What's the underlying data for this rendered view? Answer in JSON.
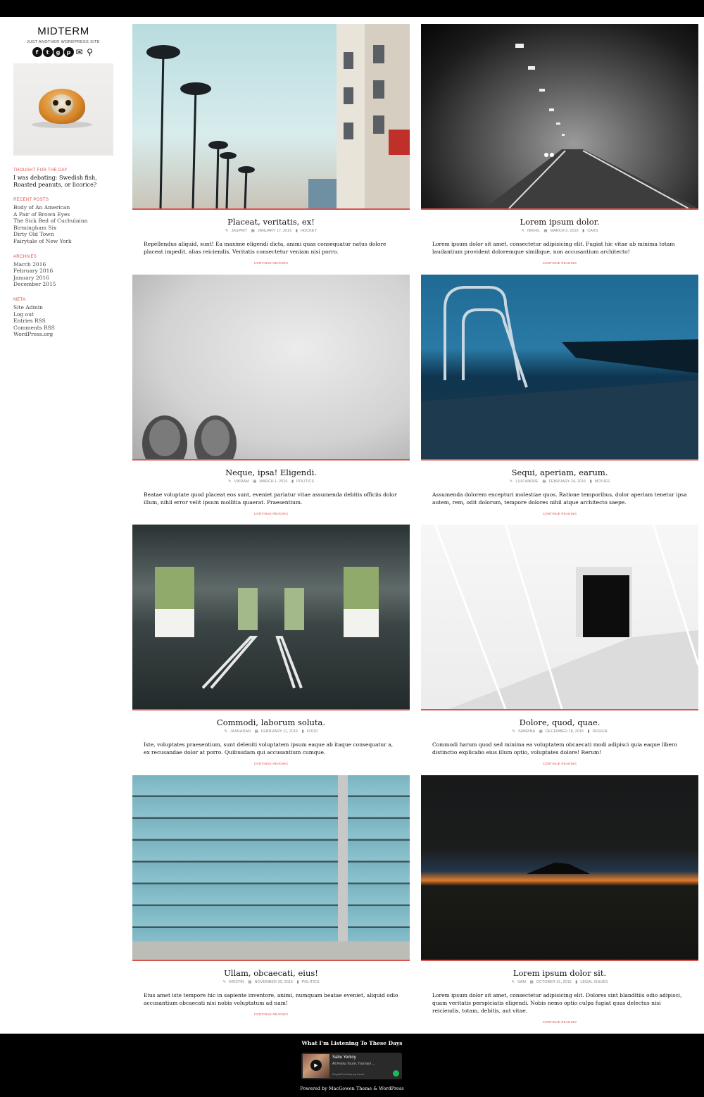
{
  "site": {
    "title": "MIDTERM",
    "description": "JUST ANOTHER WORDPRESS SITE"
  },
  "social_icons": [
    "facebook-icon",
    "twitter-icon",
    "google-plus-icon",
    "pinterest-icon",
    "email-icon",
    "search-icon"
  ],
  "sidebar": {
    "thought": {
      "title": "THOUGHT FOR THE DAY",
      "text": "I was debating: Swedish fish, Roasted peanuts, or licorice?"
    },
    "recent_posts": {
      "title": "RECENT POSTS",
      "items": [
        "Body of An American",
        "A Pair of Brown Eyes",
        "The Sick Bed of Cuchulainn",
        "Birmingham Six",
        "Dirty Old Town",
        "Fairytale of New York"
      ]
    },
    "archives": {
      "title": "ARCHIVES",
      "items": [
        "March 2016",
        "February 2016",
        "January 2016",
        "December 2015"
      ]
    },
    "meta": {
      "title": "META",
      "items": [
        "Site Admin",
        "Log out",
        "Entries RSS",
        "Comments RSS",
        "WordPress.org"
      ]
    }
  },
  "posts": [
    {
      "title": "Placeat, veritatis, ex!",
      "author": "JASPRIT",
      "date": "JANUARY 17, 2016",
      "category": "HOCKEY",
      "excerpt": "Repellendus aliquid, sunt! Ea maxime eligendi dicta, animi quas consequatur natus dolore placeat impedit, alias reiciendis. Veritatis consectetur veniam nisi porro.",
      "more": "CONTINUE READING"
    },
    {
      "title": "Lorem ipsum dolor.",
      "author": "NIKHIL",
      "date": "MARCH 2, 2016",
      "category": "CARS",
      "excerpt": "Lorem ipsum dolor sit amet, consectetur adipisicing elit. Fugiat hic vitae ab minima totam laudantium provident doloremque similique, non accusantium architecto!",
      "more": "CONTINUE READING"
    },
    {
      "title": "Neque, ipsa! Eligendi.",
      "author": "VIKRAM",
      "date": "MARCH 1, 2016",
      "category": "POLITICS",
      "excerpt": "Beatae voluptate quod placeat eos sunt, eveniet pariatur vitae assumenda debitis officiis dolor illum, nihil error velit ipsum mollitia quaerat. Praesentium.",
      "more": "CONTINUE READING"
    },
    {
      "title": "Sequi, aperiam, earum.",
      "author": "LUIZ ANDRE",
      "date": "FEBRUARY 24, 2016",
      "category": "MOVIES",
      "excerpt": "Assumenda dolorem excepturi molestiae quos. Ratione temporibus, dolor aperiam tenetur ipsa autem, rem, odit dolorum, tempore dolores nihil atque architecto saepe.",
      "more": "CONTINUE READING"
    },
    {
      "title": "Commodi, laborum soluta.",
      "author": "JASKARAN",
      "date": "FEBRUARY 11, 2016",
      "category": "FOOD",
      "excerpt": "Iste, voluptates praesentium, sunt deleniti voluptatem ipsum eaque ab itaque consequatur a, ex recusandae dolor at porro. Quibusdam qui accusantium cumque.",
      "more": "CONTINUE READING"
    },
    {
      "title": "Dolore, quod, quae.",
      "author": "SABRINA",
      "date": "DECEMBER 18, 2015",
      "category": "DESIGN",
      "excerpt": "Commodi harum quod sed minima ea voluptatem obcaecati modi adipisci quia eaque libero distinctio explicabo eius illum optio, voluptates dolore! Rerum!",
      "more": "CONTINUE READING"
    },
    {
      "title": "Ullam, obcaecati, eius!",
      "author": "KIRSTIN",
      "date": "NOVEMBER 30, 2015",
      "category": "POLITICS",
      "excerpt": "Eius amet iste tempore hic in sapiente inventore, animi, numquam beatae eveniet, aliquid odio accusantium obcaecati nisi nobis voluptatum ad nam!",
      "more": "CONTINUE READING"
    },
    {
      "title": "Lorem ipsum dolor sit.",
      "author": "SAM",
      "date": "OCTOBER 31, 2015",
      "category": "LEGAL ISSUES",
      "excerpt": "Lorem ipsum dolor sit amet, consectetur adipisicing elit. Dolores sint blanditiis odio adipisci, quam veritatis perspiciatis eligendi. Nobis nemo optio culpa fugiat quas delectus nisi reiciendis, totam, debitis, aut vitae.",
      "more": "CONTINUE READING"
    }
  ],
  "footer": {
    "widget_title": "What I'm Listening To These Days",
    "player": {
      "track": "Sabu Yerkoy",
      "artists": "Ali Farka Touré, Toumani ...",
      "playlist": "PlaylistForClass by Kevin..."
    },
    "credit": "Powered by MacGowen Theme & WordPress"
  },
  "colors": {
    "accent": "#d9534f",
    "topbar": "#000000",
    "footer_bg": "#000000"
  }
}
